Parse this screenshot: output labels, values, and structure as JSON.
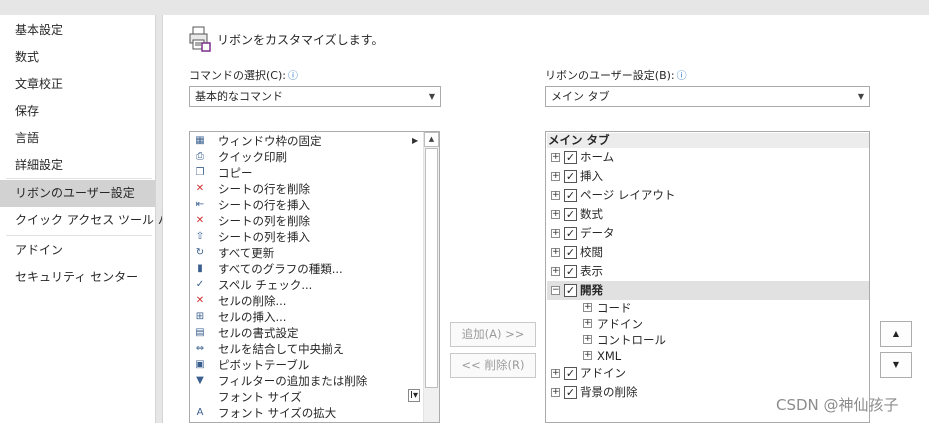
{
  "nav": {
    "items": [
      {
        "label": "基本設定",
        "selected": false
      },
      {
        "label": "数式",
        "selected": false
      },
      {
        "label": "文章校正",
        "selected": false
      },
      {
        "label": "保存",
        "selected": false
      },
      {
        "label": "言語",
        "selected": false
      },
      {
        "label": "詳細設定",
        "selected": false
      },
      {
        "label": "リボンのユーザー設定",
        "selected": true
      },
      {
        "label": "クイック アクセス ツール バー",
        "selected": false
      },
      {
        "label": "アドイン",
        "selected": false
      },
      {
        "label": "セキュリティ センター",
        "selected": false
      }
    ]
  },
  "header": {
    "title": "リボンをカスタマイズします。"
  },
  "commands": {
    "label": "コマンドの選択(C):",
    "combo_value": "基本的なコマンド",
    "items": [
      {
        "label": "ウィンドウ枠の固定",
        "icon": "freeze-panes-icon",
        "has_submenu": true
      },
      {
        "label": "クイック印刷",
        "icon": "quick-print-icon"
      },
      {
        "label": "コピー",
        "icon": "copy-icon"
      },
      {
        "label": "シートの行を削除",
        "icon": "delete-row-icon"
      },
      {
        "label": "シートの行を挿入",
        "icon": "insert-row-icon"
      },
      {
        "label": "シートの列を削除",
        "icon": "delete-column-icon"
      },
      {
        "label": "シートの列を挿入",
        "icon": "insert-column-icon"
      },
      {
        "label": "すべて更新",
        "icon": "refresh-all-icon"
      },
      {
        "label": "すべてのグラフの種類...",
        "icon": "chart-types-icon"
      },
      {
        "label": "スペル チェック...",
        "icon": "spell-check-icon"
      },
      {
        "label": "セルの削除...",
        "icon": "delete-cells-icon"
      },
      {
        "label": "セルの挿入...",
        "icon": "insert-cells-icon"
      },
      {
        "label": "セルの書式設定",
        "icon": "format-cells-icon"
      },
      {
        "label": "セルを結合して中央揃え",
        "icon": "merge-center-icon"
      },
      {
        "label": "ピボットテーブル",
        "icon": "pivot-table-icon"
      },
      {
        "label": "フィルターの追加または削除",
        "icon": "filter-icon"
      },
      {
        "label": "フォント サイズ",
        "icon": "font-size-icon"
      },
      {
        "label": "フォント サイズの拡大",
        "icon": "font-grow-icon"
      }
    ]
  },
  "buttons": {
    "add": "追加(A) >>",
    "remove": "<< 削除(R)"
  },
  "ribbon": {
    "label": "リボンのユーザー設定(B):",
    "combo_value": "メイン タブ",
    "tree_header": "メイン タブ",
    "tabs": [
      {
        "label": "ホーム",
        "checked": true,
        "expanded": false
      },
      {
        "label": "挿入",
        "checked": true,
        "expanded": false
      },
      {
        "label": "ページ レイアウト",
        "checked": true,
        "expanded": false
      },
      {
        "label": "数式",
        "checked": true,
        "expanded": false
      },
      {
        "label": "データ",
        "checked": true,
        "expanded": false
      },
      {
        "label": "校閲",
        "checked": true,
        "expanded": false
      },
      {
        "label": "表示",
        "checked": true,
        "expanded": false
      },
      {
        "label": "開発",
        "checked": true,
        "expanded": true,
        "selected": true,
        "groups": [
          "コード",
          "アドイン",
          "コントロール",
          "XML"
        ]
      },
      {
        "label": "アドイン",
        "checked": true,
        "expanded": false
      },
      {
        "label": "背景の削除",
        "checked": true,
        "expanded": false
      }
    ]
  },
  "watermark": "CSDN @神仙孩子",
  "colors": {
    "selected_bg": "#d2d2d2",
    "info_icon": "#2a78c5"
  }
}
